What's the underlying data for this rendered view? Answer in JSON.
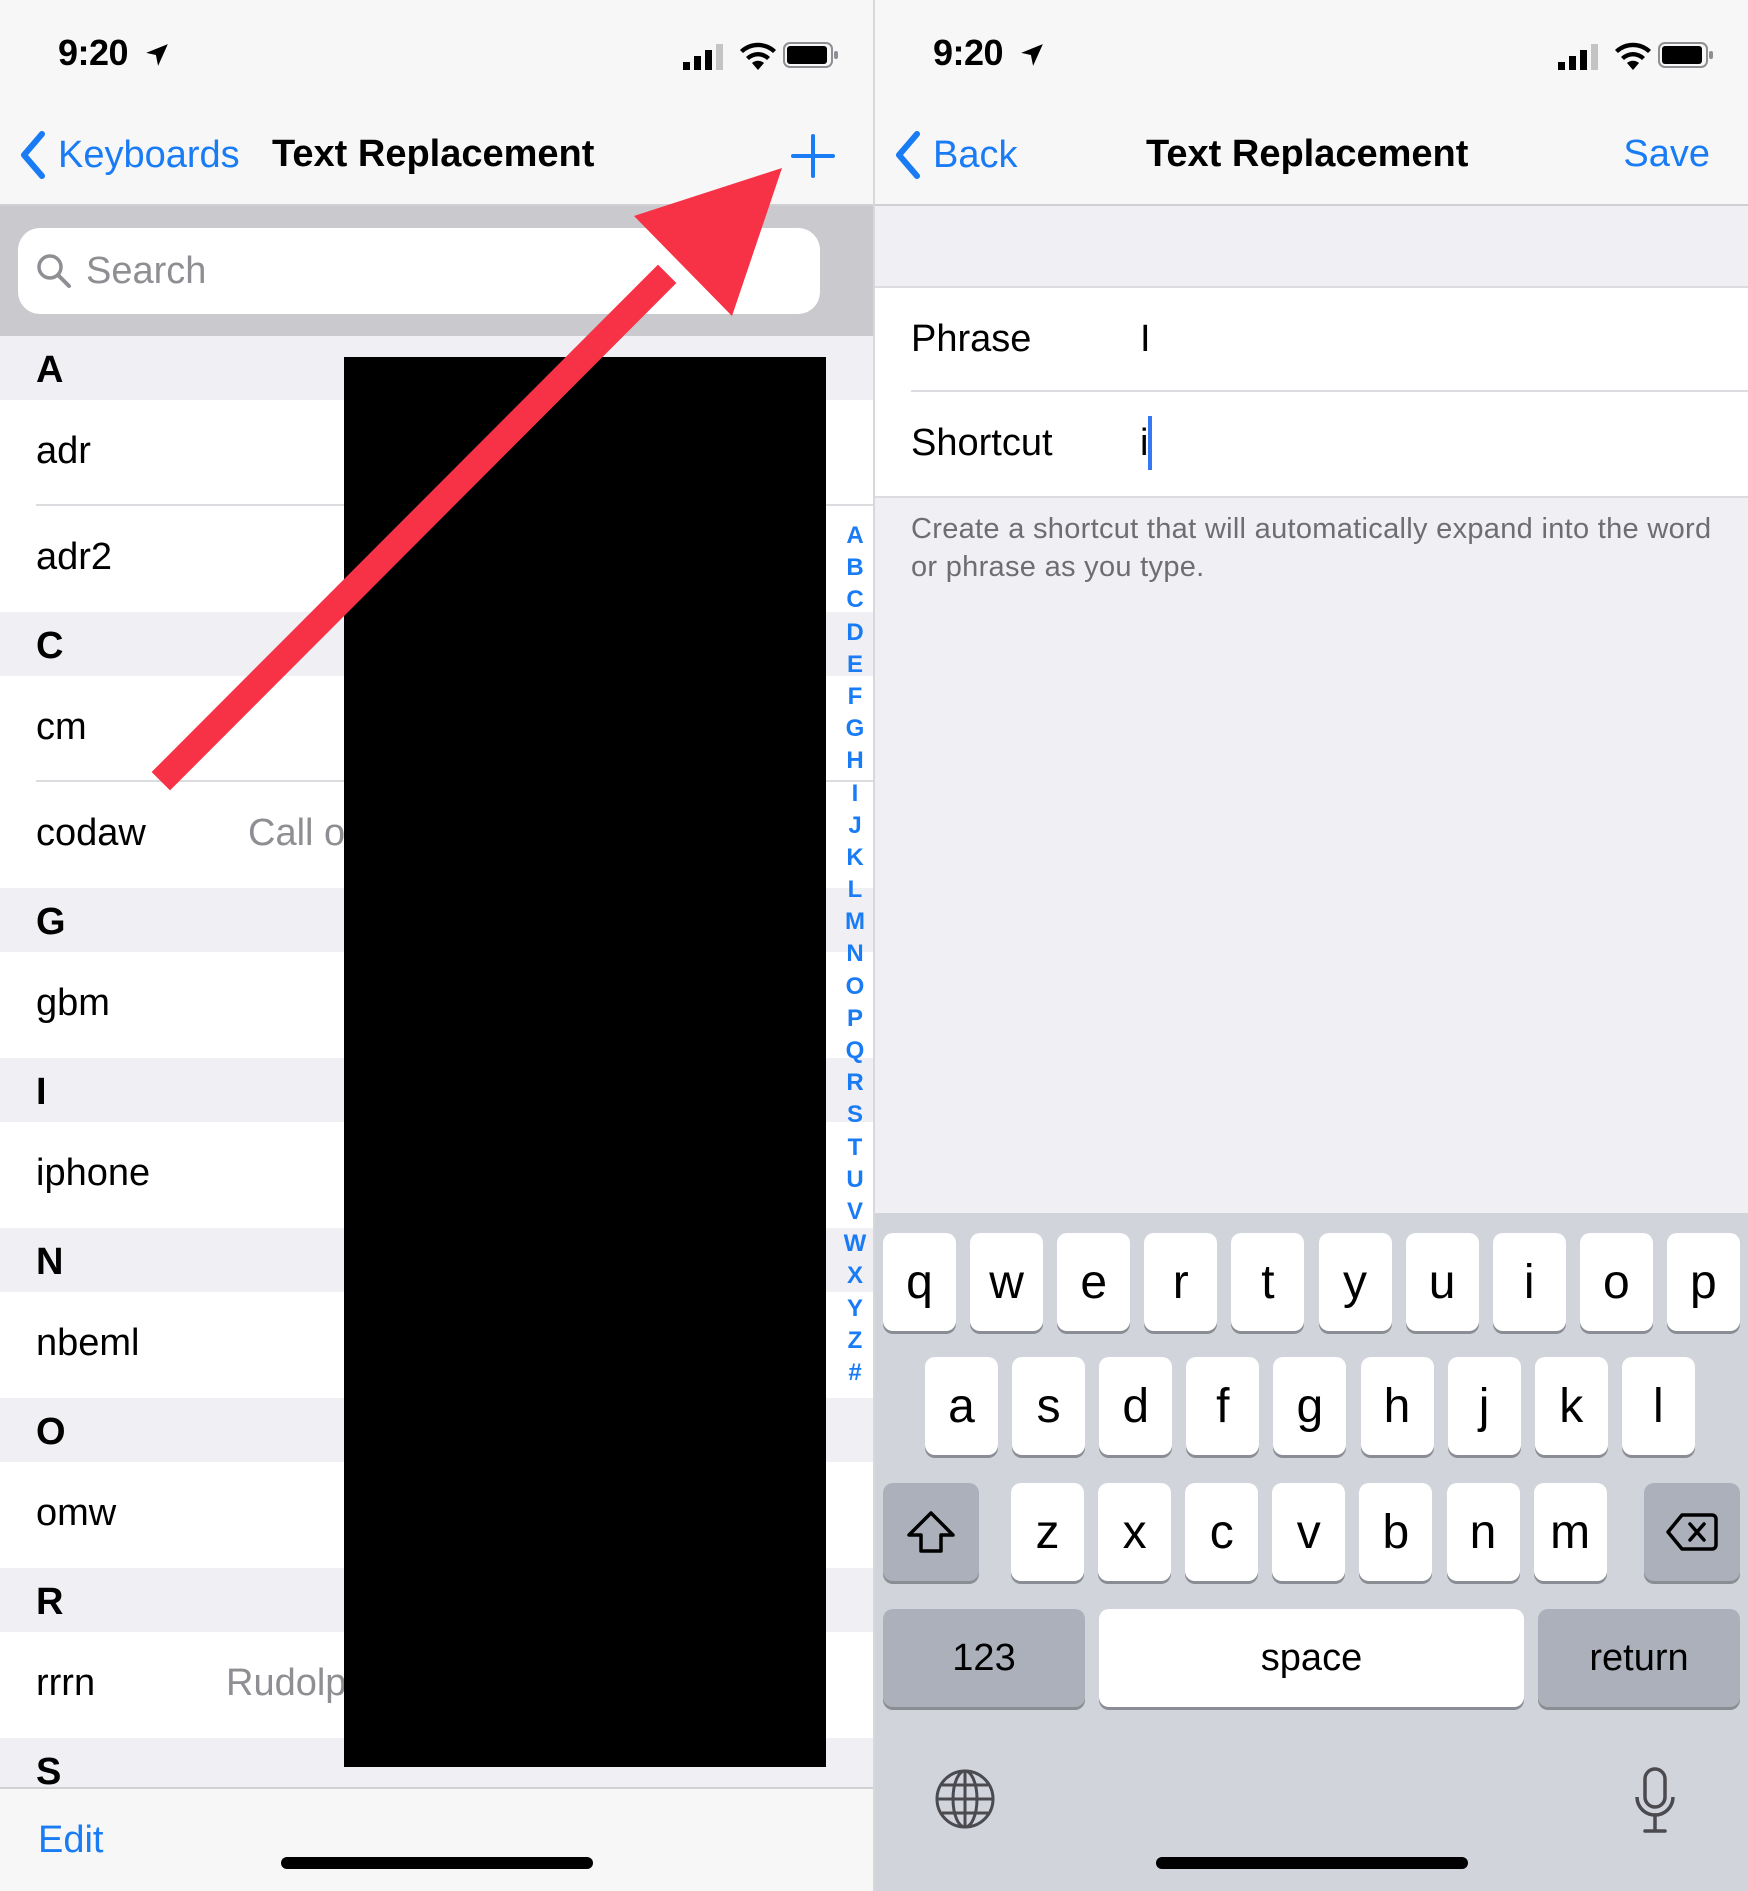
{
  "status_bar": {
    "time": "9:20"
  },
  "left": {
    "nav": {
      "back_label": "Keyboards",
      "title": "Text Replacement"
    },
    "search": {
      "placeholder": "Search"
    },
    "sections": [
      {
        "letter": "A",
        "rows": [
          {
            "shortcut": "adr",
            "phrase": ""
          },
          {
            "shortcut": "adr2",
            "phrase": ""
          }
        ]
      },
      {
        "letter": "C",
        "rows": [
          {
            "shortcut": "cm",
            "phrase": ""
          },
          {
            "shortcut": "codaw",
            "phrase": "Call o"
          }
        ]
      },
      {
        "letter": "G",
        "rows": [
          {
            "shortcut": "gbm",
            "phrase": ""
          }
        ]
      },
      {
        "letter": "I",
        "rows": [
          {
            "shortcut": "iphone",
            "phrase": ""
          }
        ]
      },
      {
        "letter": "N",
        "rows": [
          {
            "shortcut": "nbeml",
            "phrase": ""
          }
        ]
      },
      {
        "letter": "O",
        "rows": [
          {
            "shortcut": "omw",
            "phrase": ""
          }
        ]
      },
      {
        "letter": "R",
        "rows": [
          {
            "shortcut": "rrrn",
            "phrase": "Rudolp"
          }
        ]
      },
      {
        "letter": "S",
        "rows": []
      }
    ],
    "index_letters": [
      "A",
      "B",
      "C",
      "D",
      "E",
      "F",
      "G",
      "H",
      "I",
      "J",
      "K",
      "L",
      "M",
      "N",
      "O",
      "P",
      "Q",
      "R",
      "S",
      "T",
      "U",
      "V",
      "W",
      "X",
      "Y",
      "Z",
      "#"
    ],
    "toolbar": {
      "edit_label": "Edit"
    }
  },
  "right": {
    "nav": {
      "back_label": "Back",
      "title": "Text Replacement",
      "save_label": "Save"
    },
    "form": {
      "phrase_label": "Phrase",
      "phrase_value": "I",
      "shortcut_label": "Shortcut",
      "shortcut_value": "i"
    },
    "hint": "Create a shortcut that will automatically expand into the word or phrase as you type.",
    "keyboard": {
      "row1": [
        "q",
        "w",
        "e",
        "r",
        "t",
        "y",
        "u",
        "i",
        "o",
        "p"
      ],
      "row2": [
        "a",
        "s",
        "d",
        "f",
        "g",
        "h",
        "j",
        "k",
        "l"
      ],
      "row3": [
        "z",
        "x",
        "c",
        "v",
        "b",
        "n",
        "m"
      ],
      "numbers_label": "123",
      "space_label": "space",
      "return_label": "return"
    }
  },
  "colors": {
    "accent": "#1a7cf5",
    "arrow": "#f73247",
    "keyboard_bg": "#d1d4da"
  },
  "icons": [
    "location-arrow-icon",
    "signal-icon",
    "wifi-icon",
    "battery-icon",
    "chevron-left-icon",
    "plus-icon",
    "search-icon",
    "shift-icon",
    "delete-icon",
    "globe-icon",
    "microphone-icon"
  ]
}
